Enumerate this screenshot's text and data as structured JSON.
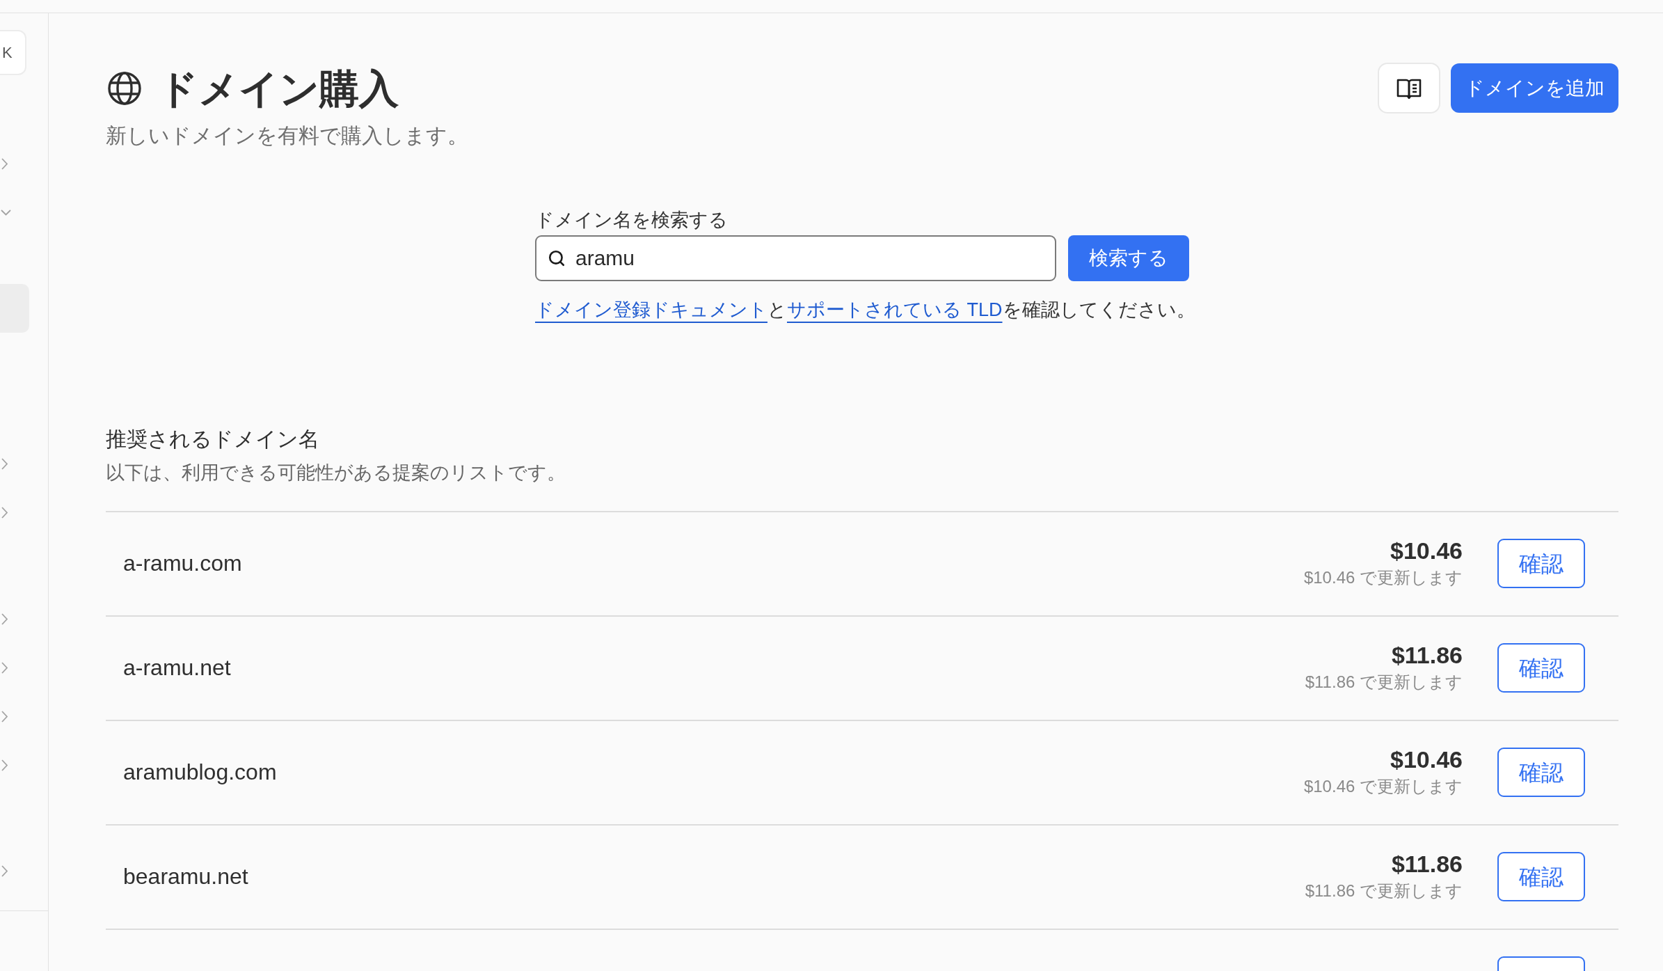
{
  "sidebar": {
    "shortcut": "K",
    "sections": [
      {
        "items": [
          {
            "selected": false,
            "expanded": false
          },
          {
            "selected": false,
            "expanded": true,
            "children": [
              {
                "selected": true
              }
            ]
          }
        ]
      },
      {
        "items": [
          {
            "selected": false,
            "expanded": false
          },
          {
            "selected": false,
            "expanded": false
          }
        ]
      },
      {
        "items": [
          {
            "selected": false,
            "expanded": false
          },
          {
            "selected": false,
            "expanded": false
          },
          {
            "selected": false,
            "expanded": false
          },
          {
            "selected": false,
            "expanded": false
          }
        ]
      },
      {
        "items": [
          {
            "selected": false,
            "expanded": false
          }
        ]
      }
    ]
  },
  "header": {
    "title": "ドメイン購入",
    "subtitle": "新しいドメインを有料で購入します。",
    "add_button": "ドメインを追加"
  },
  "search": {
    "label": "ドメイン名を検索する",
    "value": "aramu",
    "button": "検索する",
    "help": [
      {
        "kind": "link",
        "text": "ドメイン登録ドキュメント"
      },
      {
        "kind": "text",
        "text": "と"
      },
      {
        "kind": "link",
        "text": "サポートされている TLD"
      },
      {
        "kind": "text",
        "text": "を確認してください。"
      }
    ]
  },
  "suggestions": {
    "title": "推奨されるドメイン名",
    "description": "以下は、利用できる可能性がある提案のリストです。",
    "rows": [
      {
        "kind": "suggestion",
        "domain": "a-ramu.com",
        "price": "$10.46",
        "renewal": "$10.46 で更新します",
        "action": "確認"
      },
      {
        "kind": "suggestion",
        "domain": "a-ramu.net",
        "price": "$11.86",
        "renewal": "$11.86 で更新します",
        "action": "確認"
      },
      {
        "kind": "suggestion",
        "domain": "aramublog.com",
        "price": "$10.46",
        "renewal": "$10.46 で更新します",
        "action": "確認"
      },
      {
        "kind": "suggestion",
        "domain": "bearamu.net",
        "price": "$11.86",
        "renewal": "$11.86 で更新します",
        "action": "確認"
      },
      {
        "kind": "cut_off"
      }
    ]
  }
}
